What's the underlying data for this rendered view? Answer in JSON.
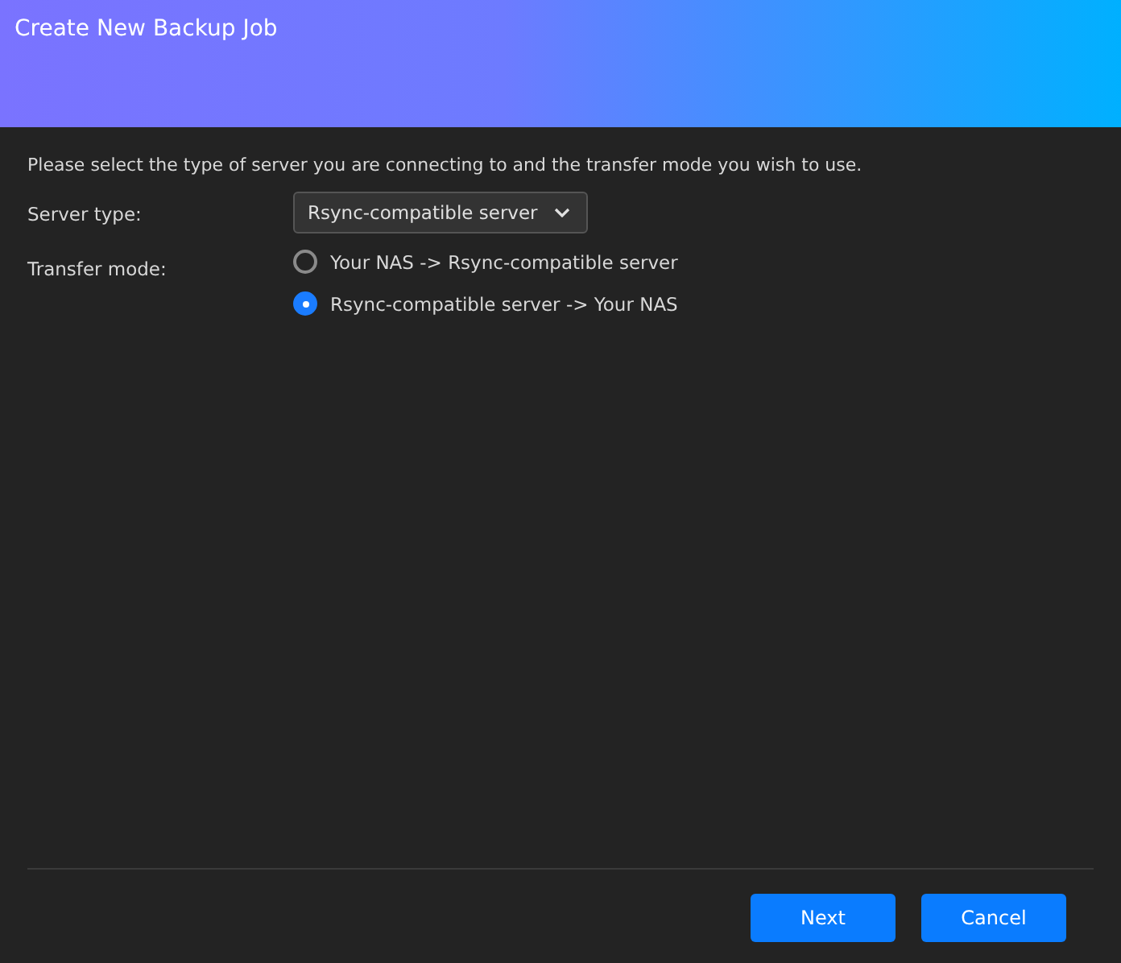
{
  "window": {
    "title": "Create New Backup Job"
  },
  "instruction": "Please select the type of server you are connecting to and the transfer mode you wish to use.",
  "server_type": {
    "label": "Server type:",
    "value": "Rsync-compatible server"
  },
  "transfer_mode": {
    "label": "Transfer mode:",
    "options": [
      {
        "label": "Your NAS -> Rsync-compatible server",
        "selected": false
      },
      {
        "label": "Rsync-compatible server -> Your NAS",
        "selected": true
      }
    ]
  },
  "buttons": [
    "Next",
    "Cancel"
  ]
}
